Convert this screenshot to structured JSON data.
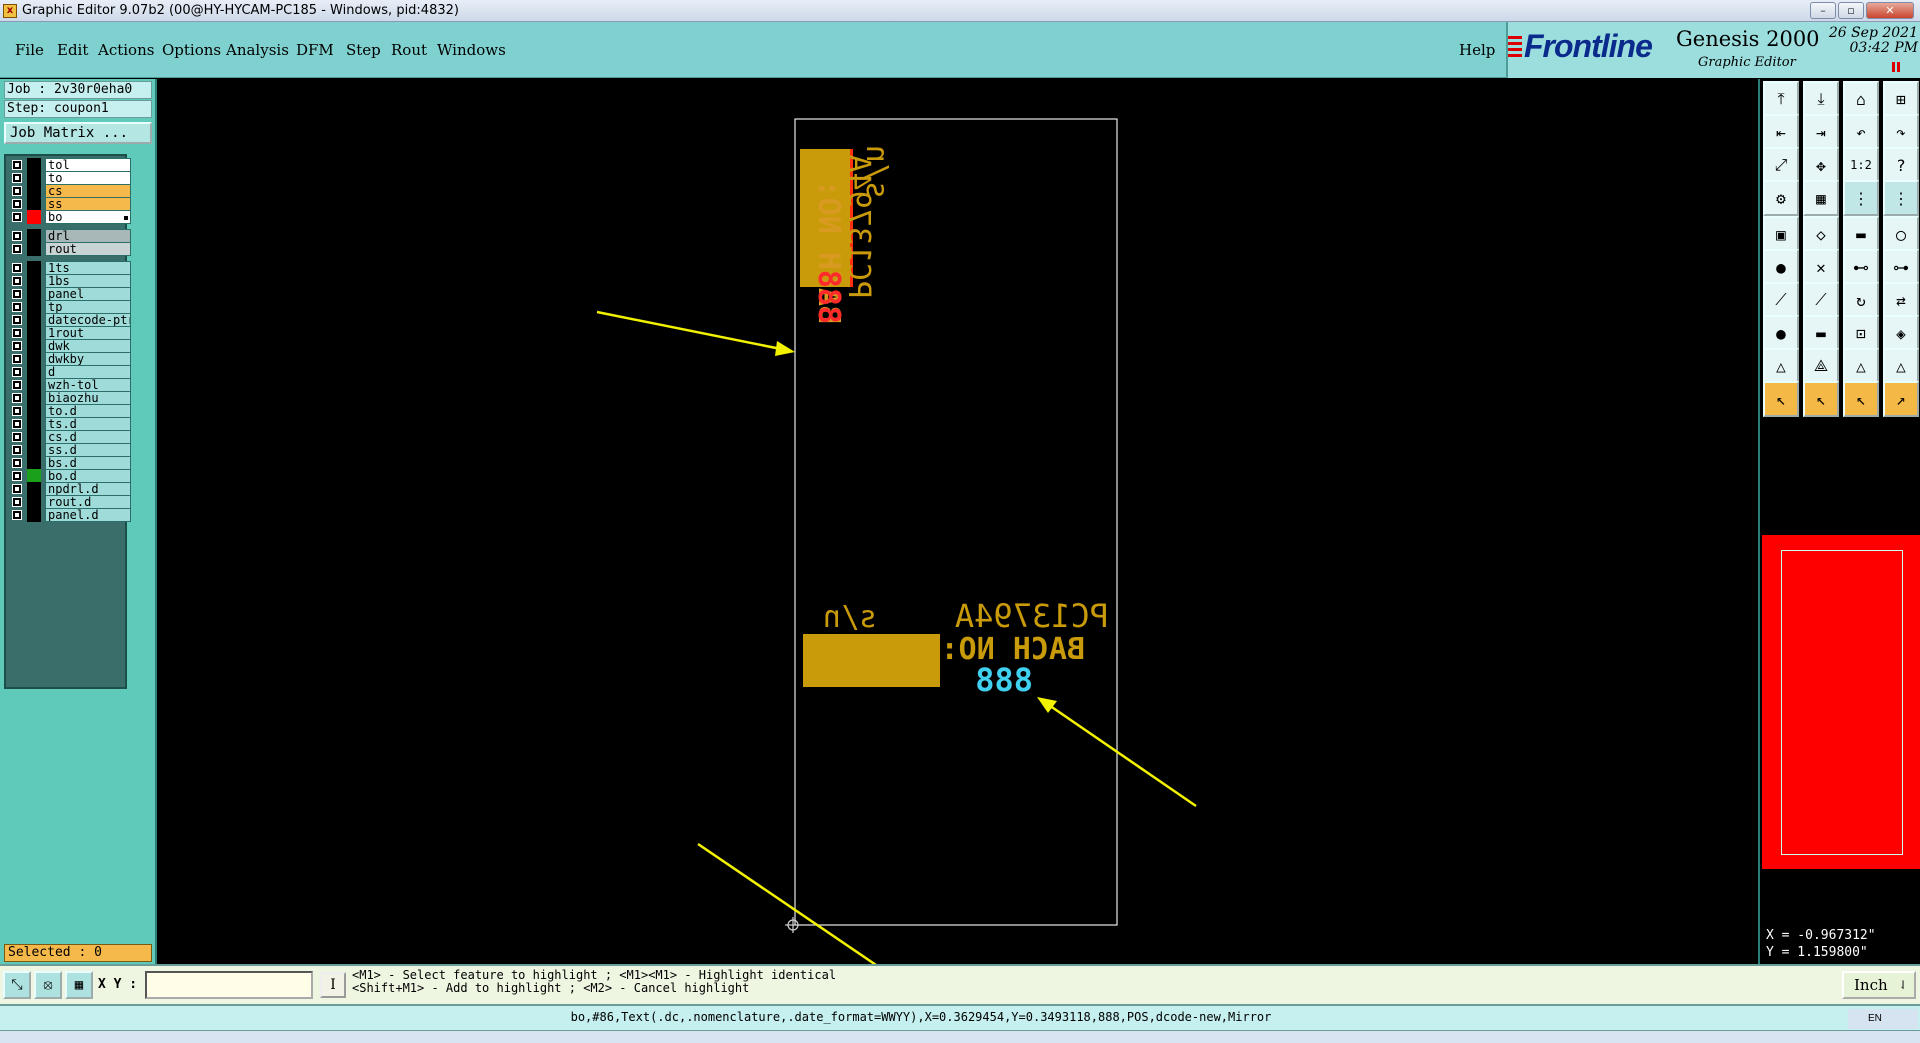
{
  "window": {
    "title": "Graphic Editor 9.07b2 (00@HY-HYCAM-PC185 - Windows, pid:4832)",
    "buttons": [
      "–",
      "▫",
      "✕"
    ]
  },
  "menu": {
    "items": [
      "File",
      "Edit",
      "Actions",
      "Options",
      "Analysis",
      "DFM",
      "Step",
      "Rout",
      "Windows"
    ],
    "help": "Help"
  },
  "branding": {
    "logo": "Frontline",
    "product": "Genesis 2000",
    "subtitle": "Graphic Editor",
    "date": "26 Sep 2021",
    "time": "03:42 PM"
  },
  "job": {
    "job_line": "Job : 2v30r0eha0",
    "step_line": "Step: coupon1",
    "matrix_button": "Job Matrix ..."
  },
  "layers": [
    {
      "name": "tol",
      "bg": "#ffffff"
    },
    {
      "name": "to",
      "bg": "#ffffff"
    },
    {
      "name": "cs",
      "bg": "#f5b84a"
    },
    {
      "name": "ss",
      "bg": "#f5b84a"
    },
    {
      "name": "bo",
      "bg": "#ffffff",
      "color": "#ff0000",
      "active": true
    },
    {
      "name": "drl",
      "bg": "#a8b8b8"
    },
    {
      "name": "rout",
      "bg": "#c8d4d4"
    },
    {
      "name": "1ts"
    },
    {
      "name": "1bs"
    },
    {
      "name": "panel"
    },
    {
      "name": "tp"
    },
    {
      "name": "datecode-ptr"
    },
    {
      "name": "1rout"
    },
    {
      "name": "dwk"
    },
    {
      "name": "dwkby"
    },
    {
      "name": "d"
    },
    {
      "name": "wzh-tol"
    },
    {
      "name": "biaozhu"
    },
    {
      "name": "to.d"
    },
    {
      "name": "ts.d"
    },
    {
      "name": "cs.d"
    },
    {
      "name": "ss.d"
    },
    {
      "name": "bs.d"
    },
    {
      "name": "bo.d",
      "color": "#1aa01a"
    },
    {
      "name": "npdrl.d"
    },
    {
      "name": "rout.d"
    },
    {
      "name": "panel.d"
    }
  ],
  "selected": "Selected : 0",
  "canvas": {
    "vertical_texts": {
      "sn": "s/n",
      "part": "PC13794A",
      "batch_label": "BACH NO:",
      "batch_value": "888"
    },
    "horizontal_texts": {
      "sn": "s/n",
      "part": "PC13794A",
      "batch_label": "BACH NO:",
      "batch_value": "888"
    }
  },
  "coords": {
    "x": "X = -0.967312\"",
    "y": "Y =  1.159800\""
  },
  "bottom": {
    "xy_label": "X Y :",
    "xy_value": "",
    "info_button": "I",
    "message_line1": "<M1> - Select feature to highlight ; <M1><M1> - Highlight identical",
    "message_line2": "<Shift+M1> - Add to highlight ; <M2> - Cancel highlight",
    "units": "Inch"
  },
  "status": "bo,#86,Text(.dc,.nomenclature,.date_format=WWYY),X=0.3629454,Y=0.3493118,888,POS,dcode-new,Mirror",
  "tray": "EN",
  "tools": [
    "open-step",
    "save",
    "home",
    "layout",
    "zoom-in",
    "zoom-out",
    "undo",
    "redo",
    "fit",
    "pan",
    "scale",
    "help",
    "settings",
    "grid",
    "snap-on",
    "snap-off",
    "pad",
    "surface",
    "line",
    "arc",
    "cross",
    "select",
    "connect",
    "move",
    "edge",
    "angle",
    "rotate",
    "mirror",
    "align",
    "join",
    "measure",
    "shape",
    "vertex",
    "triangle",
    "tri-highlight",
    "tri-on",
    "pointer",
    "pointer-alt",
    "pointer-move",
    "route"
  ],
  "colors": {
    "menubar": "#7fd1cf",
    "panel": "#5fcab9",
    "feature_yellow": "#c99a0a",
    "highlight_red": "#ff2020",
    "highlight_cyan": "#40d0f0",
    "annotation_arrow": "#f2f200"
  }
}
